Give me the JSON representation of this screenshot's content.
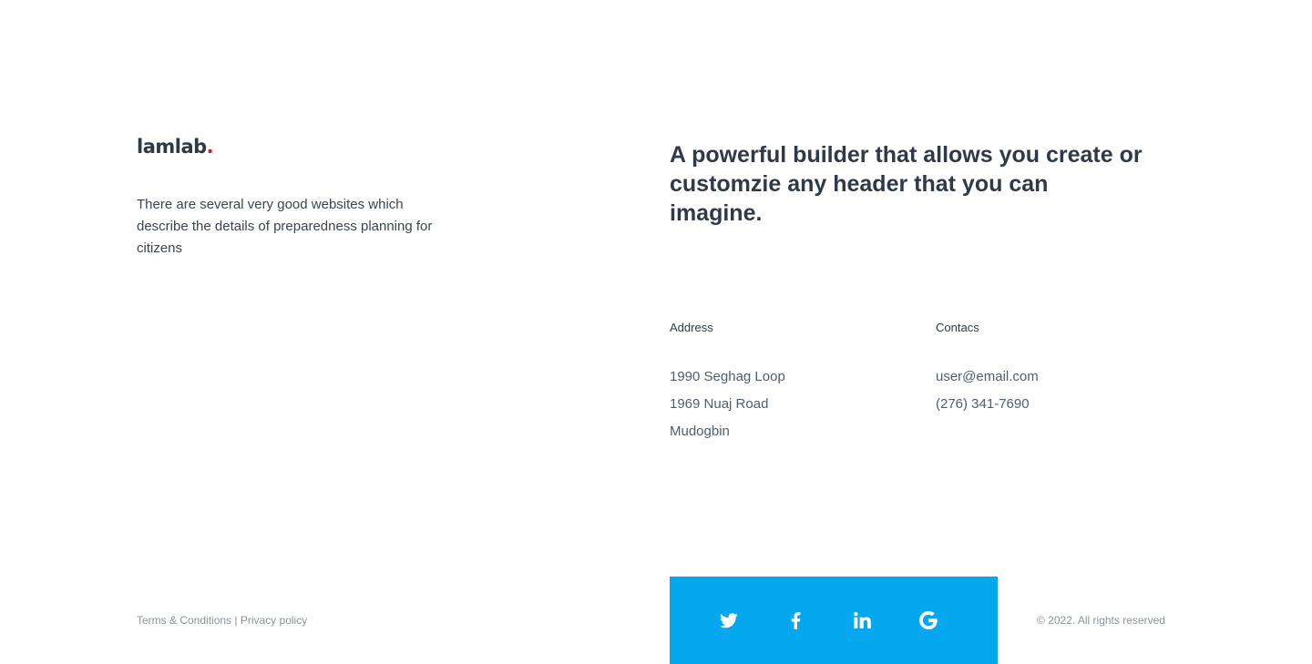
{
  "brand": {
    "name": "lamlab",
    "dot": ".",
    "dot_color": "#e8141c"
  },
  "intro": {
    "text": "There are several very good websites which describe the details of preparedness planning for citizens"
  },
  "headline": {
    "text": "A powerful builder that allows you create or customzie any header that you can imagine."
  },
  "address": {
    "title": "Address",
    "lines": [
      "1990 Seghag Loop",
      "1969 Nuaj Road",
      "Mudogbin"
    ]
  },
  "contacts": {
    "title": "Contacs",
    "email": "user@email.com",
    "phone": "(276) 341-7690"
  },
  "legal": {
    "terms": "Terms & Conditions",
    "separator": " | ",
    "privacy": "Privacy policy"
  },
  "social": {
    "bar_color": "#05a7ef",
    "icons": [
      "twitter-icon",
      "facebook-icon",
      "linkedin-icon",
      "google-icon"
    ]
  },
  "copyright": {
    "text": "© 2022. All rights reserved"
  }
}
